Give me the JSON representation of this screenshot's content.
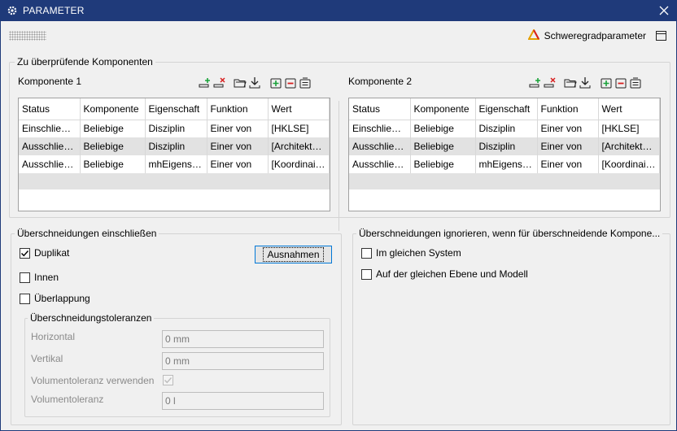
{
  "window": {
    "title": "PARAMETER",
    "colors": {
      "titlebar": "#1f3a7a",
      "accent": "#0078d7",
      "selected_row": "#e2e2e2"
    }
  },
  "header": {
    "cog_link_label": "Schweregradparameter",
    "cog_icon": "warning-triangle-icon",
    "panel_icon": "panel-layout-icon"
  },
  "components_group": {
    "title": "Zu überprüfende Komponenten",
    "toolbar_icons": [
      "add-row-icon",
      "remove-row-icon",
      "open-folder-icon",
      "import-icon",
      "add-group-icon",
      "remove-group-icon",
      "clear-icon"
    ],
    "columns": [
      "Status",
      "Komponente",
      "Eigenschaft",
      "Funktion",
      "Wert"
    ],
    "component1": {
      "label": "Komponente 1",
      "rows": [
        [
          "Einschließen",
          "Beliebige",
          "Disziplin",
          "Einer von",
          "[HKLSE]"
        ],
        [
          "Ausschließen",
          "Beliebige",
          "Disziplin",
          "Einer von",
          "[Architektur..."
        ],
        [
          "Ausschließen",
          "Beliebige",
          "mhEigensc...",
          "Einer von",
          "[Koordinait..."
        ]
      ]
    },
    "component2": {
      "label": "Komponente 2",
      "rows": [
        [
          "Einschließen",
          "Beliebige",
          "Disziplin",
          "Einer von",
          "[HKLSE]"
        ],
        [
          "Ausschließen",
          "Beliebige",
          "Disziplin",
          "Einer von",
          "[Architektur..."
        ],
        [
          "Ausschließen",
          "Beliebige",
          "mhEigensc...",
          "Einer von",
          "[Koordinait..."
        ]
      ]
    }
  },
  "include_group": {
    "title": "Überschneidungen einschließen",
    "duplicate": {
      "label": "Duplikat",
      "checked": true
    },
    "inner": {
      "label": "Innen",
      "checked": false
    },
    "overlap": {
      "label": "Überlappung",
      "checked": false
    },
    "exceptions_button": "Ausnahmen",
    "tolerances": {
      "title": "Überschneidungstoleranzen",
      "horizontal_label": "Horizontal",
      "horizontal_value": "0 mm",
      "vertical_label": "Vertikal",
      "vertical_value": "0 mm",
      "use_volume_label": "Volumentoleranz verwenden",
      "use_volume_checked": true,
      "volume_label": "Volumentoleranz",
      "volume_value": "0 l"
    }
  },
  "ignore_group": {
    "title": "Überschneidungen ignorieren, wenn für überschneidende Kompone...",
    "same_system": {
      "label": "Im gleichen System",
      "checked": false
    },
    "same_level_model": {
      "label": "Auf der gleichen Ebene und Modell",
      "checked": false
    }
  }
}
